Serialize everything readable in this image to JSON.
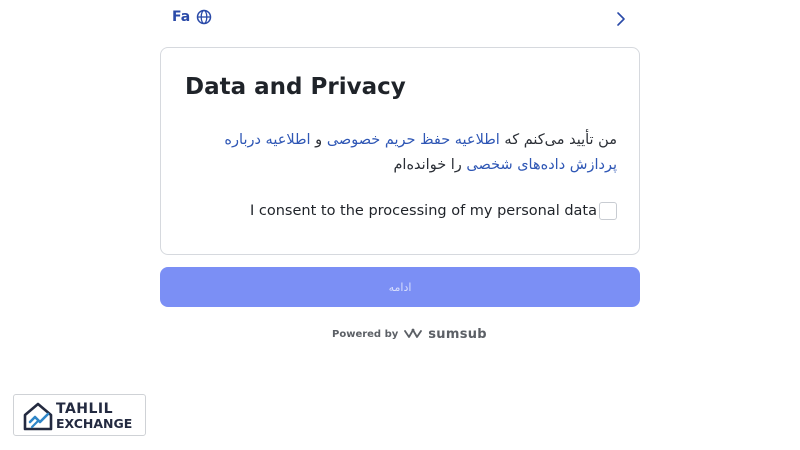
{
  "header": {
    "language_label": "Fa",
    "language_icon": "globe-icon",
    "nav_icon": "chevron-right-icon"
  },
  "card": {
    "title": "Data and Privacy",
    "consent_text": {
      "prefix": "من تأیید می‌کنم که ",
      "privacy_link": "اطلاعیه حفظ حریم خصوصی",
      "conjunction": " و ",
      "processing_link": "اطلاعیه درباره پردازش داده‌های شخصی",
      "suffix": " را خوانده‌ام"
    },
    "checkbox_label": "I consent to the processing of my personal data",
    "checkbox_checked": false
  },
  "continue_button": {
    "label": "ادامه",
    "enabled": false
  },
  "footer": {
    "powered_by": "Powered by",
    "brand": "sumsub"
  },
  "logo": {
    "line1": "TAHLIL",
    "line2": "EXCHANGE"
  },
  "colors": {
    "primary_button": "#7b8ff5",
    "link": "#2f57b5",
    "lang": "#2a4aa8",
    "logo_accent": "#2f86c8"
  }
}
